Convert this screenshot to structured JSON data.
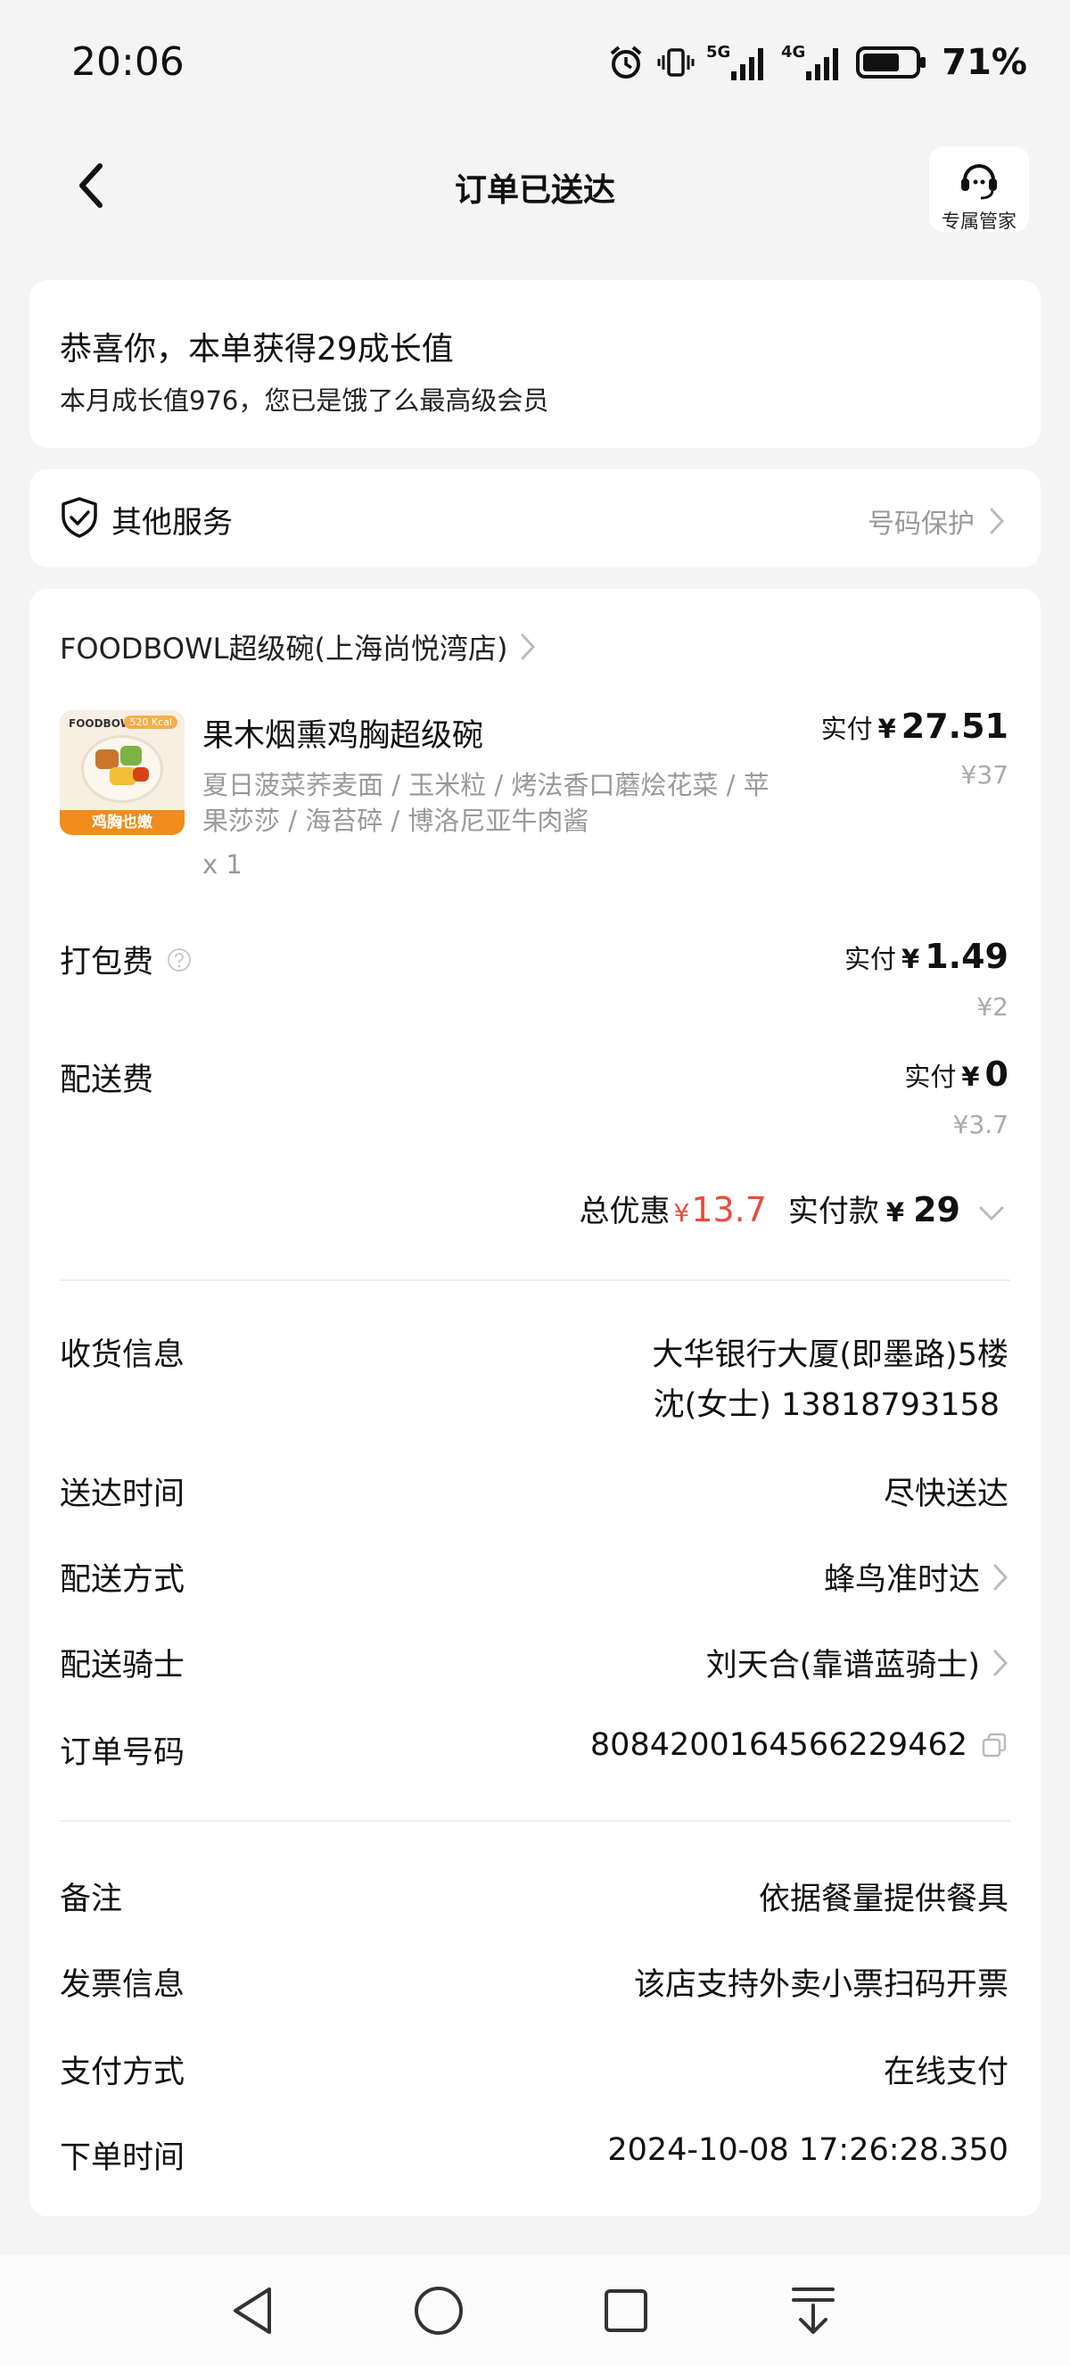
{
  "status_bar": {
    "time": "20:06",
    "network_5g": "5G",
    "network_4g": "4G",
    "battery_percent": "71%",
    "battery_level": 0.71
  },
  "header": {
    "title": "订单已送达",
    "service_label": "专属管家"
  },
  "growth": {
    "line1": "恭喜你，本单获得29成长值",
    "line2": "本月成长值976，您已是饿了么最高级会员"
  },
  "services": {
    "title": "其他服务",
    "right_text": "号码保护"
  },
  "order": {
    "shop_name": "FOODBOWL超级碗(上海尚悦湾店)",
    "item": {
      "image_brand": "FOODBOWL",
      "image_kcal": "520 Kcal",
      "image_tag": "鸡胸也嫩",
      "name": "果木烟熏鸡胸超级碗",
      "description": "夏日菠菜荞麦面 / 玉米粒 / 烤法香口蘑烩花菜 / 苹果莎莎 / 海苔碎 / 博洛尼亚牛肉酱",
      "qty": "x 1",
      "paid_label": "实付",
      "currency": "¥",
      "paid_amount": "27.51",
      "original_price": "¥37"
    },
    "packing": {
      "label": "打包费",
      "paid_label": "实付",
      "currency": "¥",
      "paid_amount": "1.49",
      "original_price": "¥2"
    },
    "delivery_fee": {
      "label": "配送费",
      "paid_label": "实付",
      "currency": "¥",
      "paid_amount": "0",
      "original_price": "¥3.7"
    },
    "totals": {
      "discount_label": "总优惠",
      "discount_currency": "¥",
      "discount_amount": "13.7",
      "pay_label": "实付款",
      "pay_currency": "¥",
      "pay_amount": "29"
    },
    "receiver": {
      "label": "收货信息",
      "address": "大华银行大厦(即墨路)5楼",
      "contact": "沈(女士) 13818793158"
    },
    "delivery_time": {
      "label": "送达时间",
      "value": "尽快送达"
    },
    "delivery_method": {
      "label": "配送方式",
      "value": "蜂鸟准时达"
    },
    "rider": {
      "label": "配送骑士",
      "value": "刘天合(靠谱蓝骑士)"
    },
    "order_no": {
      "label": "订单号码",
      "value": "8084200164566229462"
    },
    "remark": {
      "label": "备注",
      "value": "依据餐量提供餐具"
    },
    "invoice": {
      "label": "发票信息",
      "value": "该店支持外卖小票扫码开票"
    },
    "payment_method": {
      "label": "支付方式",
      "value": "在线支付"
    },
    "order_time": {
      "label": "下单时间",
      "value": "2024-10-08 17:26:28.350"
    }
  },
  "colors": {
    "discount_red": "#e84b3c",
    "muted_gray": "#999999",
    "background": "#f4f4f4"
  }
}
